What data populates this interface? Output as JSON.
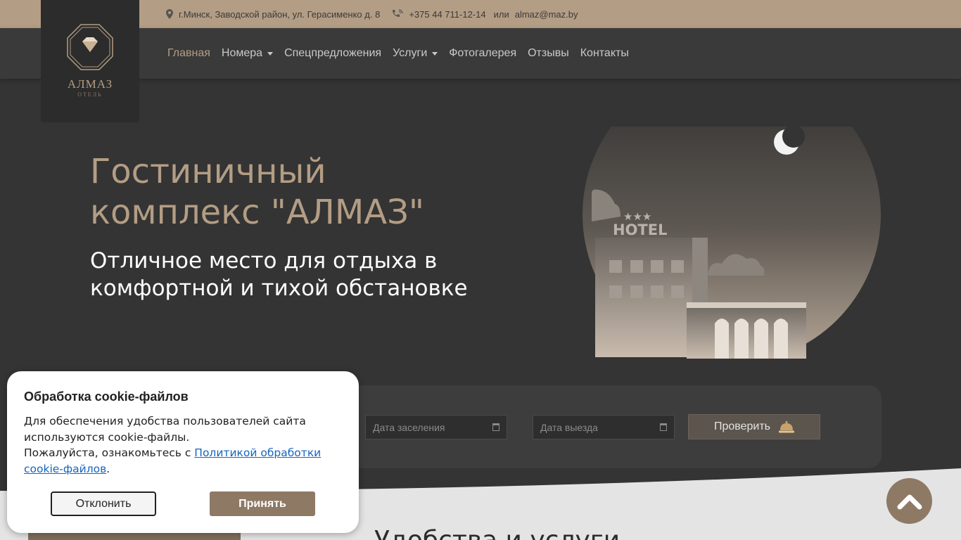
{
  "topbar": {
    "address": "г.Минск, Заводской район, ул. Герасименко д. 8",
    "phone": "+375 44 711-12-14",
    "or_text": "или",
    "email": "almaz@maz.by"
  },
  "logo": {
    "name": "АЛМАЗ",
    "subtitle": "ОТЕЛЬ"
  },
  "nav": {
    "items": [
      {
        "label": "Главная"
      },
      {
        "label": "Номера"
      },
      {
        "label": "Спецпредложения"
      },
      {
        "label": "Услуги"
      },
      {
        "label": "Фотогалерея"
      },
      {
        "label": "Отзывы"
      },
      {
        "label": "Контакты"
      }
    ]
  },
  "hero": {
    "title": "Гостиничный комплекс \"АЛМАЗ\"",
    "subtitle": "Отличное место для отдыха в комфортной и тихой обстановке",
    "sign_text": "HOTEL"
  },
  "booking": {
    "checkin_placeholder": "Дата заселения",
    "checkout_placeholder": "Дата выезда",
    "check_label": "Проверить"
  },
  "section": {
    "title": "Удобства и услуги"
  },
  "cookie": {
    "title": "Обработка cookie-файлов",
    "text_line1": "Для обеспечения удобства пользователей сайта используются cookie-файлы.",
    "text_line2_prefix": "Пожалуйста, ознакомьтесь с ",
    "policy_link": "Политикой обработки cookie-файлов",
    "text_suffix": ".",
    "decline_label": "Отклонить",
    "accept_label": "Принять"
  },
  "colors": {
    "accent": "#b39d84",
    "dark_bg": "#343434",
    "button": "#8e7965"
  },
  "icons": {
    "address": "map-pin-icon",
    "phone": "phone-icon",
    "logo": "diamond-icon",
    "check": "reception-bell-icon",
    "scroll_top": "chevron-up-icon"
  }
}
